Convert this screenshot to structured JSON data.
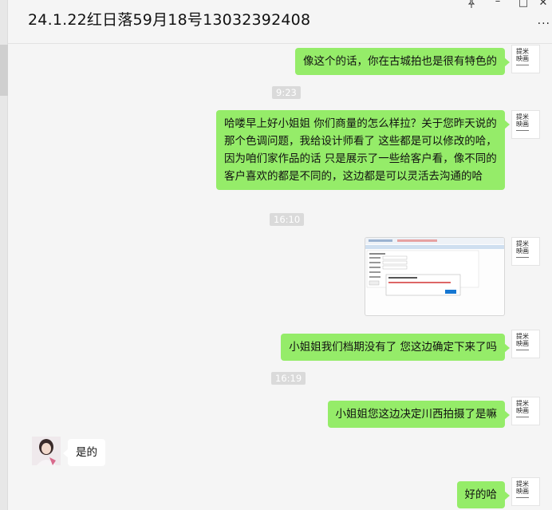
{
  "window": {
    "title": "24.1.22红日落59月18号13032392408",
    "pin_icon": "pin-icon",
    "minimize_glyph": "–",
    "maximize_glyph": "□",
    "close_glyph": "✕",
    "more_glyph": "···"
  },
  "brand_logo": {
    "line1": "提米",
    "line2": "映画"
  },
  "colors": {
    "my_bubble": "#95ec69",
    "their_bubble": "#ffffff",
    "background": "#f5f5f5"
  },
  "messages": {
    "m1": "像这个的话，你在古城拍也是很有特色的",
    "t1": "9:23",
    "m2": "哈喽早上好小姐姐 你们商量的怎么样拉？关于您昨天说的那个色调问题，我给设计师看了 这些都是可以修改的哈，因为咱们家作品的话 只是展示了一些给客户看，像不同的客户喜欢的都是不同的，这边都是可以灵活去沟通的哈",
    "t2": "16:10",
    "m3_image": "screenshot-image",
    "m4": "小姐姐我们档期没有了 您这边确定下来了吗",
    "t3": "16:19",
    "m5": "小姐姐您这边决定川西拍摄了是嘛",
    "m6": "是的",
    "m7": "好的哈"
  }
}
